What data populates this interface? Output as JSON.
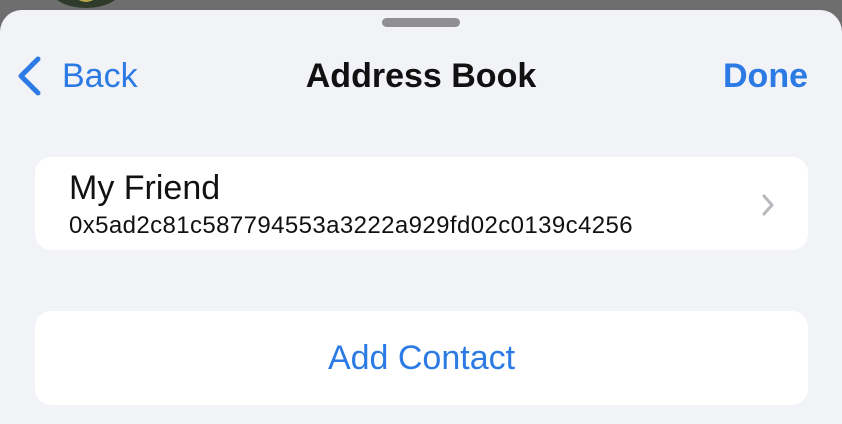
{
  "nav": {
    "back_label": "Back",
    "title": "Address Book",
    "done_label": "Done"
  },
  "contacts": [
    {
      "name": "My Friend",
      "address": "0x5ad2c81c587794553a3222a929fd02c0139c4256"
    }
  ],
  "actions": {
    "add_contact_label": "Add Contact"
  },
  "icons": {
    "back": "chevron-left-icon",
    "disclosure": "chevron-right-icon"
  },
  "colors": {
    "accent": "#2c7be5",
    "sheet_background": "#f2f3f7",
    "card_background": "#ffffff"
  }
}
